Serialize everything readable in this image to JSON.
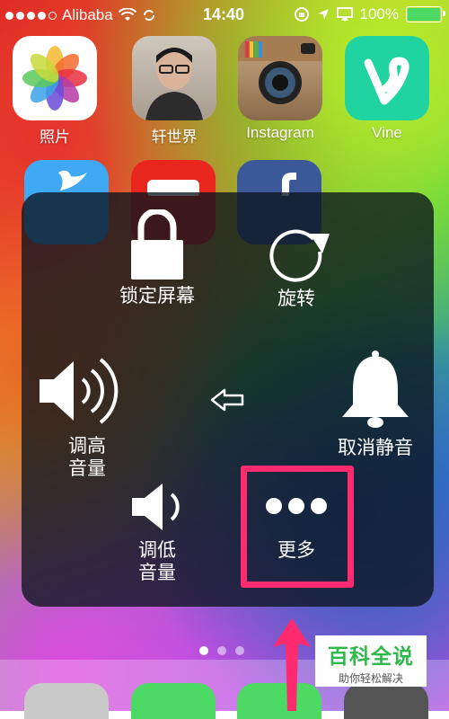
{
  "status_bar": {
    "carrier": "Alibaba",
    "time": "14:40",
    "battery": "100%",
    "signal_dots_filled": 4,
    "signal_dots_total": 5
  },
  "apps_row1": [
    {
      "label": "照片",
      "icon": "photos-icon"
    },
    {
      "label": "轩世界",
      "icon": "person-photo-icon"
    },
    {
      "label": "Instagram",
      "icon": "instagram-icon"
    },
    {
      "label": "Vine",
      "icon": "vine-icon"
    }
  ],
  "assistive_touch": {
    "lock": "锁定屏幕",
    "rotate": "旋转",
    "volume_up": [
      "调高",
      "音量"
    ],
    "mute": "取消静音",
    "volume_down": [
      "调低",
      "音量"
    ],
    "more": "更多"
  },
  "watermark": {
    "title": "百科全说",
    "subtitle": "助你轻松解决"
  },
  "colors": {
    "highlight": "#ff2b6e",
    "battery": "#4cd964",
    "watermark_green": "#2fb94a"
  },
  "page_indicator": {
    "pages": 3,
    "current": 1
  }
}
